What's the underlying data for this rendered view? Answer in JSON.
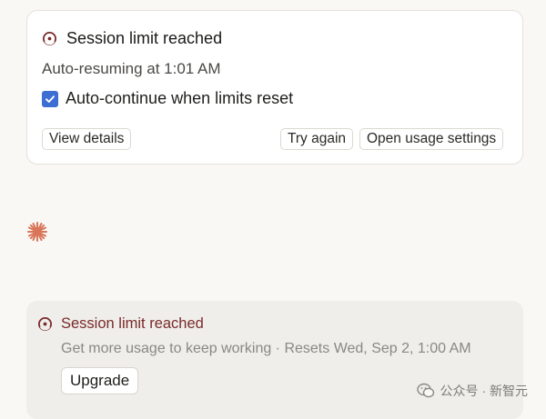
{
  "notice": {
    "title": "Session limit reached",
    "resume_text": "Auto-resuming at 1:01 AM",
    "auto_continue_label": "Auto-continue when limits reset",
    "auto_continue_checked": true,
    "view_details_label": "View details",
    "try_again_label": "Try again",
    "open_usage_label": "Open usage settings"
  },
  "banner": {
    "title": "Session limit reached",
    "subtitle": "Get more usage to keep working · Resets Wed, Sep 2, 1:00 AM",
    "upgrade_label": "Upgrade"
  },
  "watermark": {
    "text": "公众号 · 新智元"
  },
  "icons": {
    "limit": "session-limit-icon",
    "check": "check-icon",
    "spinner": "asterisk-spinner-icon",
    "watermark": "wechat-icon"
  },
  "colors": {
    "accent_check": "#3d6fd3",
    "limit_red": "#7a2a2a",
    "spinner": "#d9765a"
  }
}
